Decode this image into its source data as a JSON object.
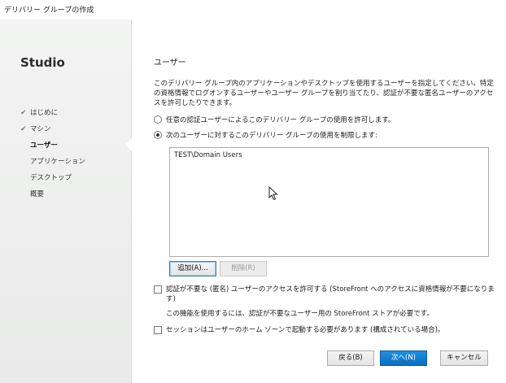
{
  "window": {
    "title": "デリバリー グループの作成"
  },
  "sidebar": {
    "brand": "Studio",
    "steps": [
      {
        "label": "はじめに",
        "done": true
      },
      {
        "label": "マシン",
        "done": true
      },
      {
        "label": "ユーザー",
        "current": true
      },
      {
        "label": "アプリケーション"
      },
      {
        "label": "デスクトップ"
      },
      {
        "label": "概要"
      }
    ]
  },
  "main": {
    "heading": "ユーザー",
    "description": "このデリバリー グループ内のアプリケーションやデスクトップを使用するユーザーを指定してください。特定の資格情報でログオンするユーザーやユーザー グループを割り当てたり、認証が不要な匿名ユーザーのアクセスを許可したりできます。",
    "radio_any": {
      "label": "任意の認証ユーザーによるこのデリバリー グループの使用を許可します。",
      "selected": false
    },
    "radio_restrict": {
      "label": "次のユーザーに対するこのデリバリー グループの使用を制限します:",
      "selected": true
    },
    "users": [
      "TEST\\Domain Users"
    ],
    "add_button": "追加(A)...",
    "remove_button": "削除(R)",
    "anon_checkbox": {
      "label": "認証が不要な (匿名) ユーザーのアクセスを許可する (StoreFront へのアクセスに資格情報が不要になります)",
      "checked": false
    },
    "anon_note": "この機能を使用するには、認証が不要なユーザー用の StoreFront ストアが必要です。",
    "homezone_checkbox": {
      "label": "セッションはユーザーのホーム ゾーンで起動する必要があります (構成されている場合)。",
      "checked": false
    }
  },
  "footer": {
    "back_button": "戻る(B)",
    "next_button": "次へ(N)",
    "cancel_button": "キャンセル"
  }
}
